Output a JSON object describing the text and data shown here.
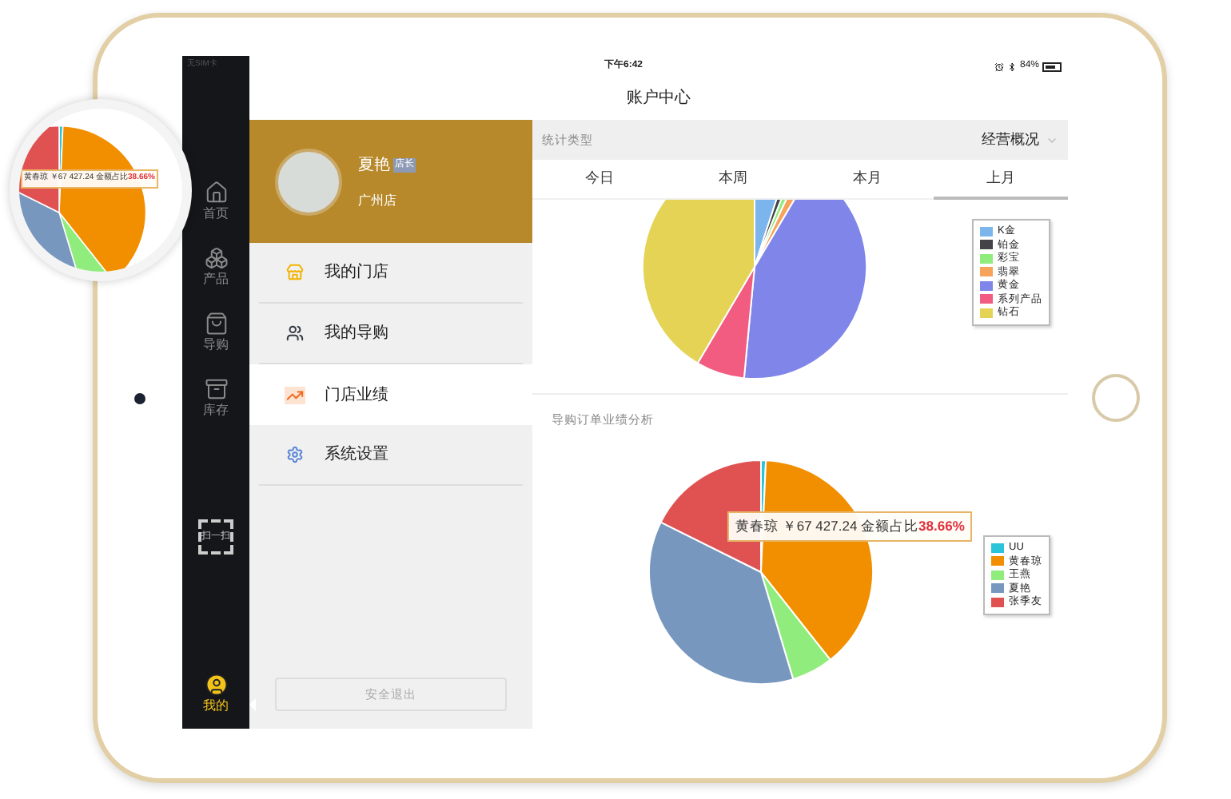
{
  "status_bar": {
    "carrier": "无SIM卡",
    "time": "下午6:42",
    "battery": "84%"
  },
  "title": "账户中心",
  "nav": [
    {
      "label": "首页",
      "kind": "home",
      "selected": false
    },
    {
      "label": "产品",
      "kind": "products",
      "selected": false
    },
    {
      "label": "导购",
      "kind": "guide",
      "selected": false
    },
    {
      "label": "库存",
      "kind": "stock",
      "selected": false
    },
    {
      "label": "扫一扫",
      "kind": "scan",
      "selected": false
    },
    {
      "label": "我的",
      "kind": "me",
      "selected": true
    }
  ],
  "profile": {
    "name": "夏艳",
    "role": "店长",
    "store": "广州店"
  },
  "menu": [
    {
      "label": "我的门店",
      "kind": "store",
      "selected": false
    },
    {
      "label": "我的导购",
      "kind": "staff",
      "selected": false
    },
    {
      "label": "门店业绩",
      "kind": "performance",
      "selected": true
    },
    {
      "label": "系统设置",
      "kind": "settings",
      "selected": false
    }
  ],
  "logout": "安全退出",
  "filter": {
    "label": "统计类型",
    "value": "经营概况"
  },
  "tabs": [
    {
      "label": "今日",
      "selected": false
    },
    {
      "label": "本周",
      "selected": false
    },
    {
      "label": "本月",
      "selected": false
    },
    {
      "label": "上月",
      "selected": true
    }
  ],
  "category_chart": {
    "legend": [
      {
        "label": "K金",
        "color": "#7cb5ec"
      },
      {
        "label": "铂金",
        "color": "#434348"
      },
      {
        "label": "彩宝",
        "color": "#90ed7d"
      },
      {
        "label": "翡翠",
        "color": "#f7a35c"
      },
      {
        "label": "黄金",
        "color": "#8085e9"
      },
      {
        "label": "系列产品",
        "color": "#f15c80"
      },
      {
        "label": "钻石",
        "color": "#e4d354"
      }
    ]
  },
  "guide_chart": {
    "title": "导购订单业绩分析",
    "legend": [
      {
        "label": "UU",
        "color": "#2bc4d8"
      },
      {
        "label": "黄春琼",
        "color": "#f28f00"
      },
      {
        "label": "王燕",
        "color": "#90ed7d"
      },
      {
        "label": "夏艳",
        "color": "#7797bf"
      },
      {
        "label": "张季友",
        "color": "#e05252"
      }
    ],
    "tooltip": {
      "text": "黄春琼 ￥67 427.24 金额占比",
      "share": "38.66%"
    }
  },
  "magnifier": {
    "tooltip": {
      "text": "黄春琼 ￥67 427.24 金额占比",
      "share": "38.66%"
    }
  }
}
